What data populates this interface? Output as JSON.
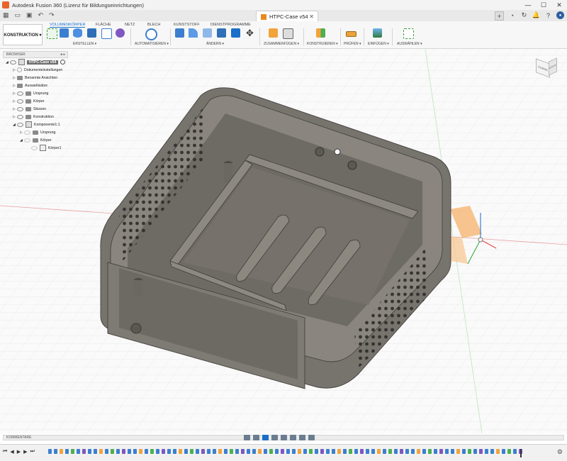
{
  "app": {
    "title": "Autodesk Fusion 360 (Lizenz für Bildungseinrichtungen)"
  },
  "window_controls": [
    "—",
    "☐",
    "✕"
  ],
  "document_tab": {
    "label": "HTPC-Case v54",
    "close": "✕"
  },
  "workspace": {
    "label": "KONSTRUKTION ▾"
  },
  "ribbon_tabs": [
    {
      "label": "VOLUMENKÖRPER",
      "active": true
    },
    {
      "label": "FLÄCHE",
      "active": false
    },
    {
      "label": "NETZ",
      "active": false
    },
    {
      "label": "BLECH",
      "active": false
    },
    {
      "label": "KUNSTSTOFF",
      "active": false
    },
    {
      "label": "DIENSTPROGRAMME",
      "active": false
    }
  ],
  "toolbar_groups": [
    {
      "label": "ERSTELLEN"
    },
    {
      "label": "AUTOMATISIEREN"
    },
    {
      "label": "ÄNDERN"
    },
    {
      "label": "ZUSAMMENFÜGEN"
    },
    {
      "label": "KONSTRUIEREN"
    },
    {
      "label": "PRÜFEN"
    },
    {
      "label": "EINFÜGEN"
    },
    {
      "label": "AUSWÄHLEN"
    }
  ],
  "browser": {
    "header": "BROWSER",
    "items": [
      {
        "label": "HTPC-Case v54",
        "type": "root",
        "indent": 0
      },
      {
        "label": "Dokumenteinstellungen",
        "type": "gear",
        "indent": 1
      },
      {
        "label": "Benannte Ansichten",
        "type": "folder",
        "indent": 1
      },
      {
        "label": "Auswahlsätze",
        "type": "folder",
        "indent": 1
      },
      {
        "label": "Ursprung",
        "type": "folder",
        "indent": 1
      },
      {
        "label": "Körper",
        "type": "folder",
        "indent": 1
      },
      {
        "label": "Skizzen",
        "type": "folder",
        "indent": 1
      },
      {
        "label": "Konstruktion",
        "type": "folder",
        "indent": 1
      },
      {
        "label": "Komponente1:1",
        "type": "component",
        "indent": 1
      },
      {
        "label": "Ursprung",
        "type": "folder",
        "indent": 2
      },
      {
        "label": "Körper",
        "type": "folder",
        "indent": 2
      },
      {
        "label": "Körper1",
        "type": "body",
        "indent": 3
      }
    ]
  },
  "viewcube": {
    "front": "VORNE",
    "right": "RECHTS"
  },
  "comments": {
    "label": "KOMMENTARE"
  },
  "colors": {
    "accent": "#1a6fc9",
    "model_body": "#77736d",
    "model_floor": "#6e6a64",
    "axis_red": "#e24b4b",
    "axis_green": "#3fb04b",
    "origin_orange": "#f6b26b"
  }
}
